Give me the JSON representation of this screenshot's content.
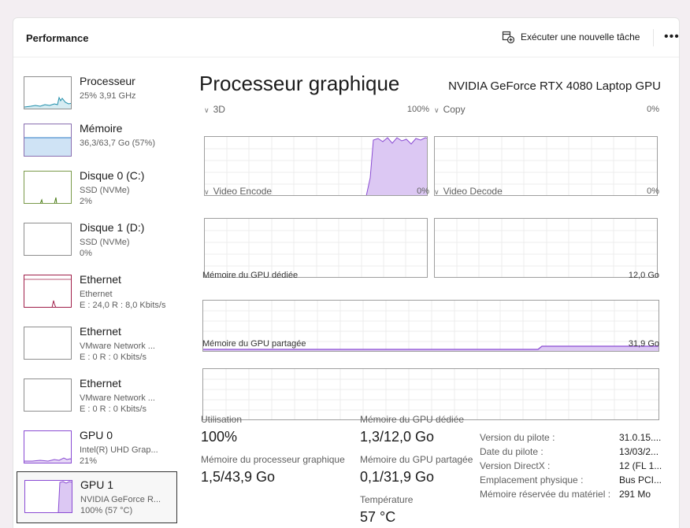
{
  "header": {
    "title": "Performance",
    "run_task_label": "Exécuter une nouvelle tâche",
    "more_label": "•••"
  },
  "sidebar": {
    "items": [
      {
        "name": "Processeur",
        "sub1": "25% 3,91 GHz",
        "sub2": ""
      },
      {
        "name": "Mémoire",
        "sub1": "36,3/63,7 Go (57%)",
        "sub2": ""
      },
      {
        "name": "Disque 0 (C:)",
        "sub1": "SSD (NVMe)",
        "sub2": "2%"
      },
      {
        "name": "Disque 1 (D:)",
        "sub1": "SSD (NVMe)",
        "sub2": "0%"
      },
      {
        "name": "Ethernet",
        "sub1": "Ethernet",
        "sub2": "E : 24,0 R : 8,0 Kbits/s"
      },
      {
        "name": "Ethernet",
        "sub1": "VMware Network ...",
        "sub2": "E : 0 R : 0 Kbits/s"
      },
      {
        "name": "Ethernet",
        "sub1": "VMware Network ...",
        "sub2": "E : 0 R : 0 Kbits/s"
      },
      {
        "name": "GPU 0",
        "sub1": "Intel(R) UHD Grap...",
        "sub2": "21%"
      },
      {
        "name": "GPU 1",
        "sub1": "NVIDIA GeForce R...",
        "sub2": "100% (57 °C)"
      }
    ]
  },
  "main": {
    "title": "Processeur graphique",
    "gpu_model": "NVIDIA GeForce RTX 4080 Laptop GPU",
    "graphs": [
      {
        "label": "3D",
        "pct": "100%"
      },
      {
        "label": "Copy",
        "pct": "0%"
      },
      {
        "label": "Video Encode",
        "pct": "0%"
      },
      {
        "label": "Video Decode",
        "pct": "0%"
      }
    ],
    "mem_dedicated_label": "Mémoire du GPU dédiée",
    "mem_dedicated_max": "12,0 Go",
    "mem_shared_label": "Mémoire du GPU partagée",
    "mem_shared_max": "31,9 Go"
  },
  "stats": {
    "utilisation_label": "Utilisation",
    "utilisation_value": "100%",
    "proc_mem_label": "Mémoire du processeur graphique",
    "proc_mem_value": "1,5/43,9 Go",
    "ded_label": "Mémoire du GPU dédiée",
    "ded_value": "1,3/12,0 Go",
    "shared_label": "Mémoire du GPU partagée",
    "shared_value": "0,1/31,9 Go",
    "temp_label": "Température",
    "temp_value": "57 °C"
  },
  "info": [
    {
      "label": "Version du pilote :",
      "value": "31.0.15...."
    },
    {
      "label": "Date du pilote :",
      "value": "13/03/2..."
    },
    {
      "label": "Version DirectX :",
      "value": "12 (FL 1..."
    },
    {
      "label": "Emplacement physique :",
      "value": "Bus PCI..."
    },
    {
      "label": "Mémoire réservée du matériel :",
      "value": "291 Mo"
    }
  ],
  "colors": {
    "cpu": "#1f8eaa",
    "memory": "#6b3fa0",
    "disk": "#4b7d18",
    "ethernet": "#a0204a",
    "gpu": "#8a4bd3",
    "gpu_fill": "#dcc8f3"
  }
}
